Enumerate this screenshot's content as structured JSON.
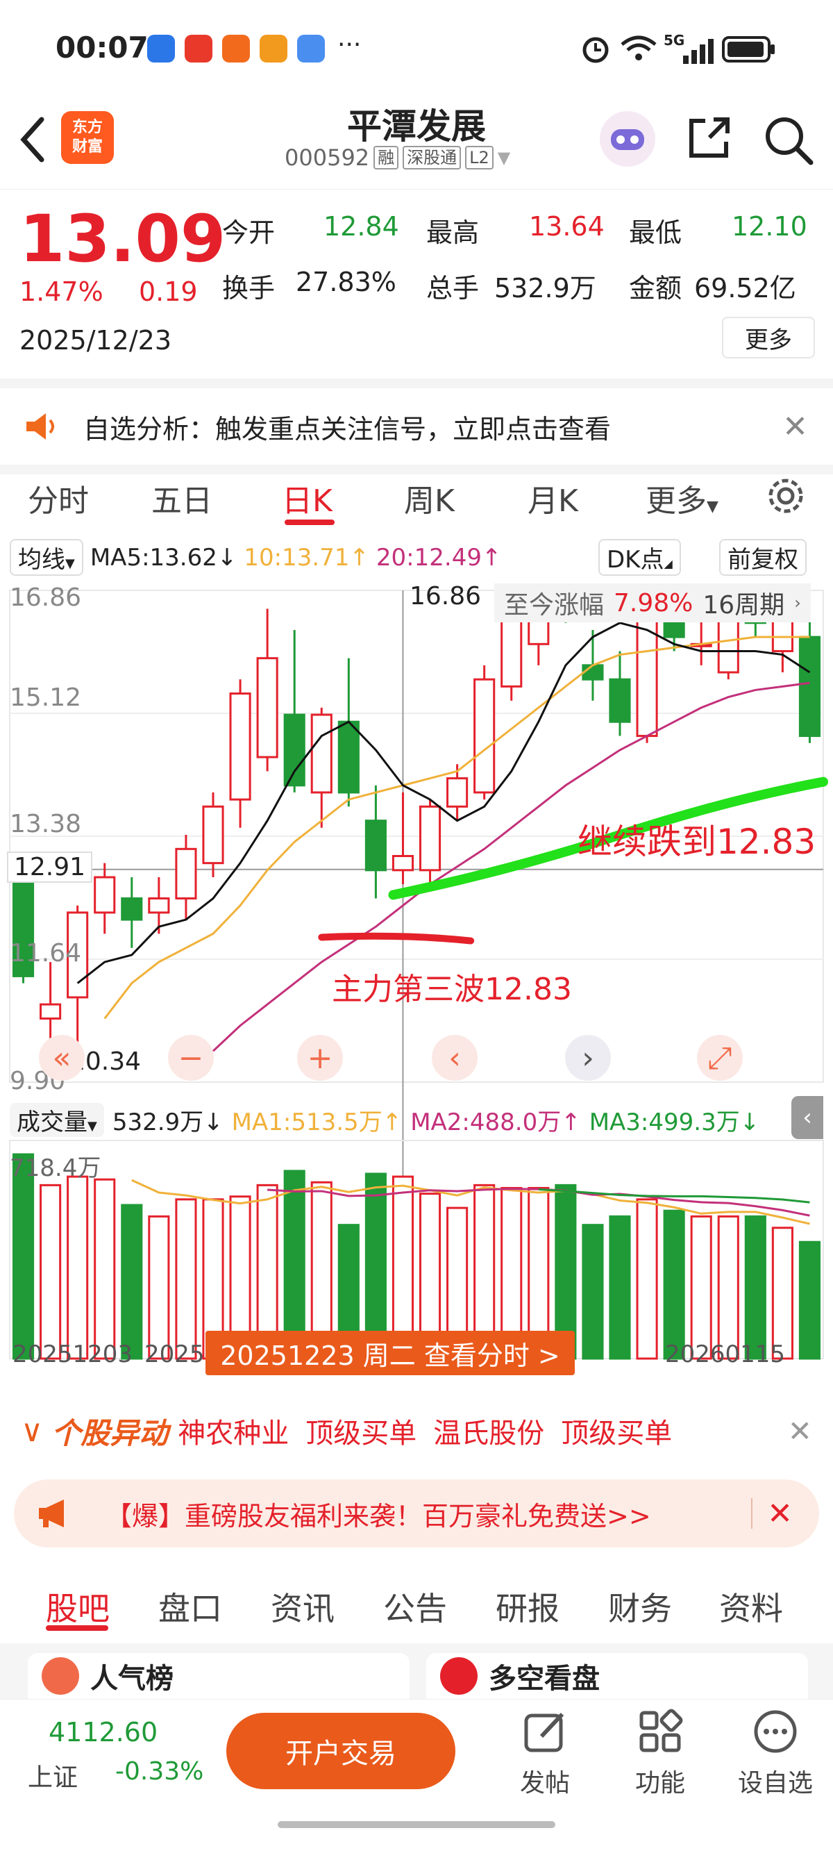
{
  "status_bar": {
    "time": "00:07",
    "network": "5G",
    "more": "···"
  },
  "header": {
    "logo_line1": "东方",
    "logo_line2": "财富",
    "stock_name": "平潭发展",
    "stock_code": "000592",
    "tags": [
      "融",
      "深股通",
      "L2"
    ]
  },
  "quote": {
    "price": "13.09",
    "change_pct": "1.47%",
    "change": "0.19",
    "date": "2025/12/23",
    "open_label": "今开",
    "open": "12.84",
    "high_label": "最高",
    "high": "13.64",
    "low_label": "最低",
    "low": "12.10",
    "turnover_label": "换手",
    "turnover": "27.83%",
    "volume_label": "总手",
    "volume": "532.9万",
    "amount_label": "金额",
    "amount": "69.52亿",
    "more_label": "更多"
  },
  "notice": {
    "text": "自选分析：触发重点关注信号，立即点击查看"
  },
  "chart_tabs": {
    "items": [
      "分时",
      "五日",
      "日K",
      "周K",
      "月K",
      "更多"
    ],
    "active": "日K"
  },
  "ma_bar": {
    "type_label": "均线",
    "ma5": "MA5:13.62↓",
    "ma10": "10:13.71↑",
    "ma20": "20:12.49↑",
    "dk_label": "DK点",
    "adjust_label": "前复权"
  },
  "kline": {
    "y_labels": [
      "16.86",
      "15.12",
      "13.38",
      "11.64",
      "9.90"
    ],
    "crosshair_price": "12.91",
    "high_marker": "16.86",
    "low_marker": "10.34",
    "info_label": "至今涨幅",
    "info_value": "7.98%",
    "info_period": "16周期",
    "annotation_green": "继续跌到12.83",
    "annotation_red": "主力第三波12.83",
    "colors": {
      "up": "#e4212b",
      "down": "#1f9a37",
      "ma5": "#111111",
      "ma10": "#f0b13a",
      "ma20": "#c3307a",
      "annot_green": "#22e019"
    }
  },
  "volume_bar": {
    "label": "成交量",
    "value": "532.9万↓",
    "ma1": "MA1:513.5万↑",
    "ma2": "MA2:488.0万↑",
    "ma3": "MA3:499.3万↓",
    "max_label": "718.4万"
  },
  "chart_data": {
    "type": "candlestick",
    "ylim": [
      9.9,
      16.86
    ],
    "candles": [
      {
        "o": 12.9,
        "c": 11.4,
        "h": 13.0,
        "l": 11.3
      },
      {
        "o": 10.8,
        "c": 11.0,
        "h": 11.6,
        "l": 10.4
      },
      {
        "o": 11.1,
        "c": 12.3,
        "h": 12.4,
        "l": 10.34
      },
      {
        "o": 12.3,
        "c": 12.8,
        "h": 13.0,
        "l": 12.0
      },
      {
        "o": 12.5,
        "c": 12.2,
        "h": 12.8,
        "l": 11.8
      },
      {
        "o": 12.3,
        "c": 12.5,
        "h": 12.8,
        "l": 12.0
      },
      {
        "o": 12.5,
        "c": 13.2,
        "h": 13.4,
        "l": 12.2
      },
      {
        "o": 13.0,
        "c": 13.8,
        "h": 14.0,
        "l": 12.8
      },
      {
        "o": 13.9,
        "c": 15.4,
        "h": 15.6,
        "l": 13.5
      },
      {
        "o": 14.5,
        "c": 15.9,
        "h": 16.6,
        "l": 14.3
      },
      {
        "o": 15.1,
        "c": 14.1,
        "h": 16.3,
        "l": 14.0
      },
      {
        "o": 14.0,
        "c": 15.1,
        "h": 15.2,
        "l": 13.5
      },
      {
        "o": 15.0,
        "c": 14.0,
        "h": 15.9,
        "l": 13.8
      },
      {
        "o": 13.6,
        "c": 12.9,
        "h": 14.1,
        "l": 12.5
      },
      {
        "o": 12.9,
        "c": 13.1,
        "h": 14.0,
        "l": 12.7
      },
      {
        "o": 12.9,
        "c": 13.8,
        "h": 13.9,
        "l": 12.7
      },
      {
        "o": 13.8,
        "c": 14.2,
        "h": 14.4,
        "l": 13.6
      },
      {
        "o": 14.0,
        "c": 15.6,
        "h": 15.8,
        "l": 13.9
      },
      {
        "o": 15.5,
        "c": 16.86,
        "h": 16.86,
        "l": 15.3
      },
      {
        "o": 16.1,
        "c": 17.4,
        "h": 17.7,
        "l": 15.8
      },
      {
        "o": 17.3,
        "c": 16.6,
        "h": 17.8,
        "l": 16.4
      },
      {
        "o": 15.8,
        "c": 15.6,
        "h": 16.3,
        "l": 15.3
      },
      {
        "o": 15.6,
        "c": 15.0,
        "h": 16.0,
        "l": 14.8
      },
      {
        "o": 14.8,
        "c": 16.5,
        "h": 17.0,
        "l": 14.7
      },
      {
        "o": 16.4,
        "c": 16.2,
        "h": 17.1,
        "l": 16.0
      },
      {
        "o": 16.1,
        "c": 16.1,
        "h": 16.9,
        "l": 15.8
      },
      {
        "o": 15.7,
        "c": 16.5,
        "h": 16.9,
        "l": 15.6
      },
      {
        "o": 16.6,
        "c": 16.4,
        "h": 17.6,
        "l": 16.2
      },
      {
        "o": 16.0,
        "c": 16.6,
        "h": 17.1,
        "l": 15.7
      },
      {
        "o": 16.2,
        "c": 14.8,
        "h": 16.7,
        "l": 14.7
      }
    ],
    "ma5": [
      null,
      null,
      11.3,
      11.6,
      11.7,
      12.1,
      12.2,
      12.5,
      13.0,
      13.6,
      14.3,
      14.8,
      15.0,
      14.6,
      14.1,
      13.9,
      13.6,
      13.8,
      14.3,
      15.0,
      15.8,
      16.2,
      16.4,
      16.3,
      16.1,
      16.0,
      16.0,
      16.0,
      15.95,
      15.7
    ],
    "ma10": [
      null,
      null,
      null,
      10.8,
      11.3,
      11.6,
      11.8,
      12.0,
      12.4,
      12.9,
      13.3,
      13.6,
      13.9,
      14.0,
      14.1,
      14.2,
      14.3,
      14.6,
      14.9,
      15.2,
      15.5,
      15.8,
      15.95,
      16.0,
      16.05,
      16.1,
      16.15,
      16.2,
      16.2,
      16.2
    ],
    "ma20": [
      null,
      null,
      null,
      null,
      null,
      null,
      null,
      10.34,
      10.7,
      11.0,
      11.3,
      11.6,
      11.85,
      12.1,
      12.4,
      12.7,
      12.95,
      13.2,
      13.5,
      13.8,
      14.1,
      14.35,
      14.6,
      14.8,
      15.0,
      15.2,
      15.35,
      15.45,
      15.5,
      15.55
    ],
    "volumes": [
      718.4,
      610,
      640,
      630,
      540,
      500,
      560,
      560,
      570,
      610,
      660,
      620,
      470,
      650,
      640,
      580,
      530,
      610,
      600,
      600,
      610,
      470,
      500,
      560,
      520,
      500,
      500,
      500,
      460,
      410
    ],
    "x_labels": [
      "20251203",
      "2025",
      "20260115"
    ],
    "selected_date_label": "20251223 周二 查看分时 >"
  },
  "ticker": {
    "title": "个股异动",
    "items": [
      "神农种业",
      "顶级买单",
      "温氏股份",
      "顶级买单"
    ]
  },
  "banner": {
    "text": "【爆】重磅股友福利来袭！百万豪礼免费送>>"
  },
  "bottom_tabs": {
    "items": [
      "股吧",
      "盘口",
      "资讯",
      "公告",
      "研报",
      "财务",
      "资料"
    ],
    "active": "股吧"
  },
  "cards": {
    "left": "人气榜",
    "right": "多空看盘"
  },
  "bottom_bar": {
    "index_value": "4112.60",
    "index_name": "上证",
    "index_change": "-0.33%",
    "trade_button": "开户交易",
    "nav": [
      "发帖",
      "功能",
      "设自选"
    ]
  }
}
